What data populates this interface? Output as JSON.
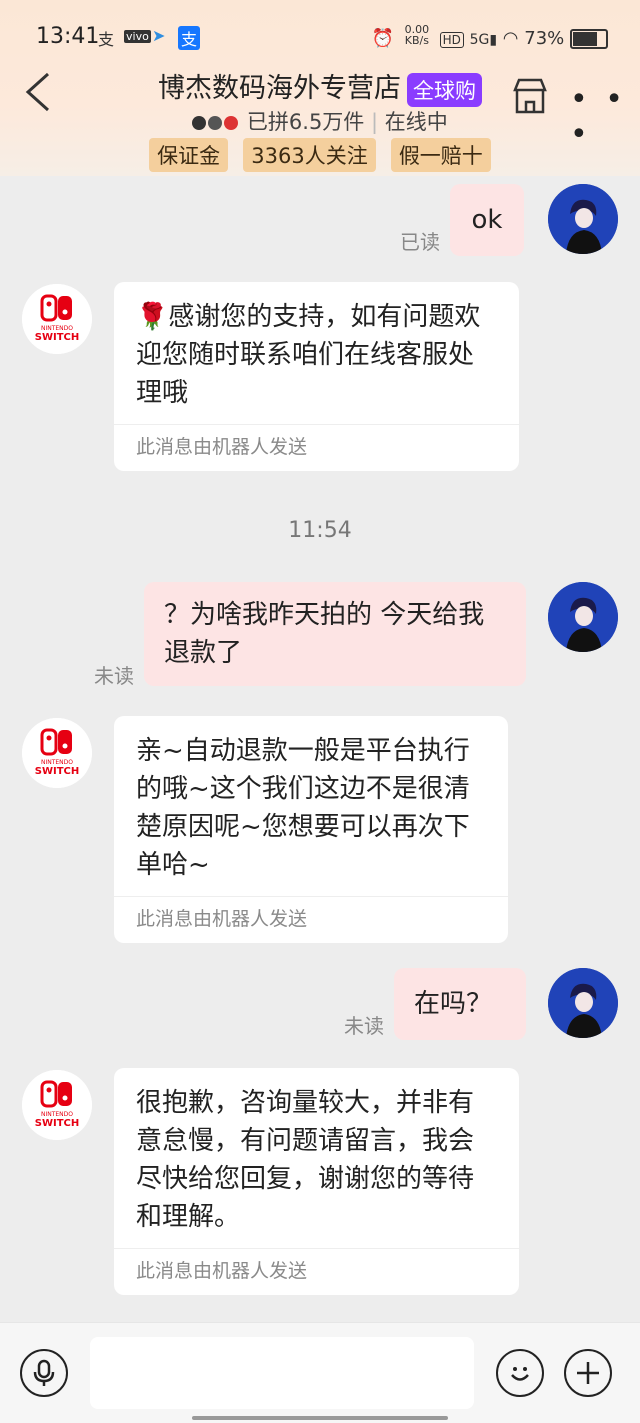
{
  "status_bar": {
    "time": "13:41",
    "net_speed": "0.00 KB/s",
    "battery": "73%"
  },
  "header": {
    "title": "博杰数码海外专营店",
    "global_tag": "全球购",
    "group_count": "已拼6.5万件",
    "online": "在线中",
    "tags": [
      "保证金",
      "3363人关注",
      "假一赔十"
    ]
  },
  "messages": {
    "m1": {
      "text": "ok",
      "status": "已读"
    },
    "m2": {
      "text": "🌹感谢您的支持，如有问题欢迎您随时联系咱们在线客服处理哦",
      "robot_note": "此消息由机器人发送"
    },
    "timestamp": "11:54",
    "m3": {
      "text": "？为啥我昨天拍的 今天给我退款了",
      "status": "未读"
    },
    "m4": {
      "text": "亲~自动退款一般是平台执行的哦~这个我们这边不是很清楚原因呢~您想要可以再次下单哈~",
      "robot_note": "此消息由机器人发送"
    },
    "m5": {
      "text": "在吗？",
      "status": "未读"
    },
    "m6": {
      "text": "很抱歉，咨询量较大，并非有意怠慢，有问题请留言，我会尽快给您回复，谢谢您的等待和理解。",
      "robot_note": "此消息由机器人发送"
    }
  },
  "shop_logo": {
    "line1": "NINTENDO",
    "line2": "SWITCH"
  },
  "colors": {
    "accent_purple": "#8a3cff",
    "tag_bg": "#f4cf9d",
    "my_bubble": "#fde4e4",
    "nintendo_red": "#e60012"
  }
}
